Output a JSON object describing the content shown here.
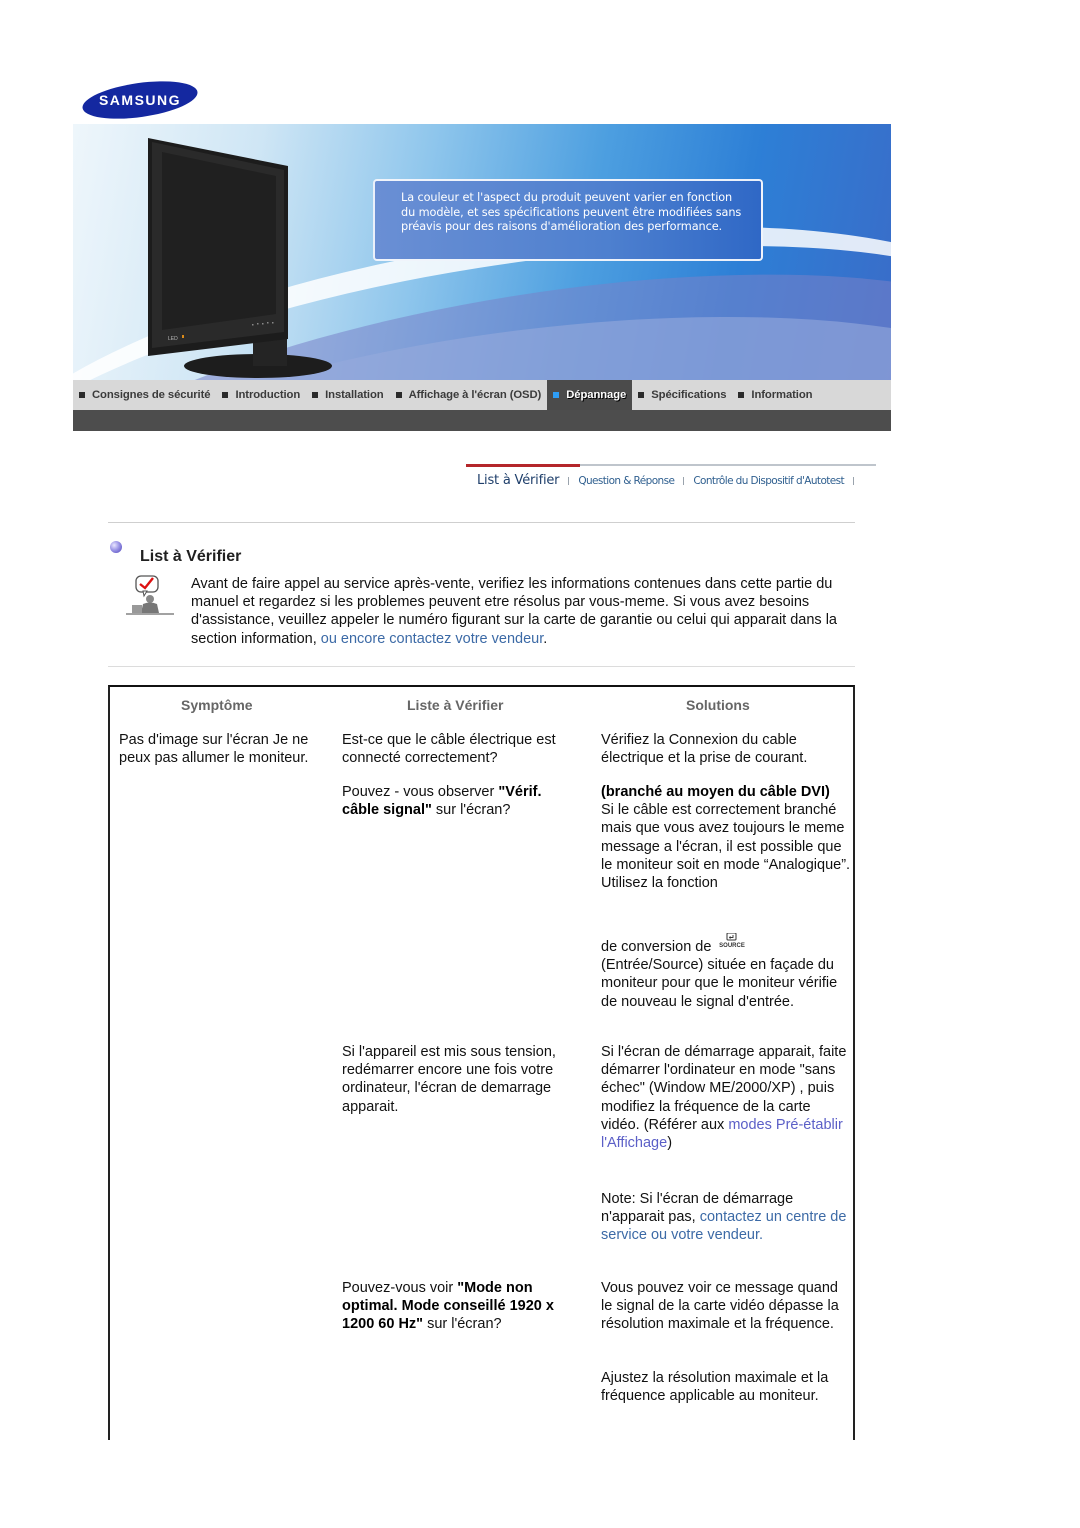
{
  "brand": {
    "logo_text": "SAMSUNG",
    "logo_color": "#1428a0"
  },
  "hero": {
    "notice": "La couleur et l'aspect du produit peuvent varier en fonction du modèle, et ses spécifications peuvent être modifiées sans préavis pour des raisons d'amélioration des performance."
  },
  "main_nav": {
    "items": [
      {
        "label": "Consignes de sécurité",
        "active": false
      },
      {
        "label": "Introduction",
        "active": false
      },
      {
        "label": "Installation",
        "active": false
      },
      {
        "label": "Affichage à l'écran (OSD)",
        "active": false
      },
      {
        "label": "Dépannage",
        "active": true
      },
      {
        "label": "Spécifications",
        "active": false
      },
      {
        "label": "Information",
        "active": false
      }
    ],
    "active_color": "#2e9df5"
  },
  "sub_tabs": {
    "items": [
      {
        "label": "List à Vérifier",
        "active": true
      },
      {
        "label": "Question & Réponse",
        "active": false
      },
      {
        "label": "Contrôle du Dispositif d'Autotest",
        "active": false
      }
    ],
    "active_underline_color": "#b4262a"
  },
  "section": {
    "title": "List à Vérifier",
    "intro_text": "Avant de faire appel au service après-vente, verifiez les informations contenues dans cette partie du manuel et regardez si les problemes peuvent etre résolus par vous-meme. Si vous avez besoins d'assistance, veuillez appeler le numéro figurant sur la carte de garantie ou celui qui apparait dans la section information, ",
    "intro_link": "ou encore contactez votre vendeur",
    "intro_end": "."
  },
  "table": {
    "headers": [
      "Symptôme",
      "Liste à Vérifier",
      "Solutions"
    ],
    "symptom": "Pas d'image sur l'écran Je ne peux pas allumer le moniteur.",
    "rows": [
      {
        "check": "Est-ce que le câble électrique est connecté correctement?",
        "solution": "Vérifiez la Connexion du cable électrique et la prise de courant."
      },
      {
        "check_pre": "Pouvez - vous observer ",
        "check_bold": "\"Vérif. câble signal\"",
        "check_post": " sur l'écran?",
        "solution_bold": "(branché au moyen du câble DVI)",
        "solution_text": "Si le câble est correctement branché mais que vous avez toujours le meme message a l'écran, il est possible que le moniteur soit en mode “Analogique”. Utilisez la fonction",
        "solution_text2_pre": "de conversion de ",
        "source_icon_label": "SOURCE",
        "solution_text2_post": " (Entrée/Source) située en façade du moniteur pour que le moniteur vérifie de nouveau le signal d'entrée."
      },
      {
        "check": "Si l'appareil est mis sous tension, redémarrer encore une fois votre ordinateur, l'écran de demarrage apparait.",
        "solution_pre": "Si l'écran de démarrage apparait, faite démarrer l'ordinateur en mode \"sans échec\" (Window ME/2000/XP) , puis modifiez la fréquence de la carte vidéo. (Référer aux ",
        "solution_link": "modes Pré-établir l'Affichage",
        "solution_post": ")",
        "note_pre": "Note: Si l'écran de démarrage n'apparait pas, ",
        "note_link": "contactez un centre de service ou votre vendeur.",
        "note_post": "."
      },
      {
        "check_pre": "Pouvez-vous voir ",
        "check_bold": "\"Mode non optimal. Mode conseillé 1920 x 1200 60 Hz\"",
        "check_post": " sur l'écran?",
        "solution": "Vous pouvez voir ce message quand le signal de la carte vidéo dépasse la résolution maximale et la fréquence.",
        "solution2": "Ajustez la résolution maximale et la fréquence applicable au moniteur."
      }
    ]
  }
}
